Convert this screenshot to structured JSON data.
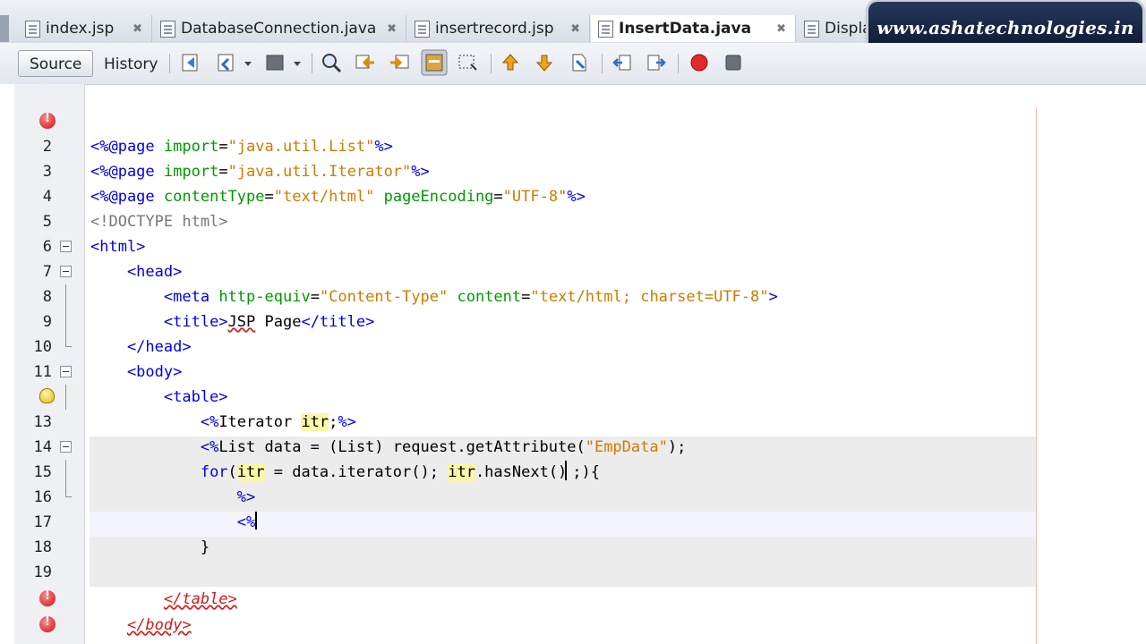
{
  "tabs": [
    {
      "label": "index.jsp",
      "active": false
    },
    {
      "label": "DatabaseConnection.java",
      "active": false
    },
    {
      "label": "insertrecord.jsp",
      "active": false
    },
    {
      "label": "InsertData.java",
      "active": true
    },
    {
      "label": "Displa",
      "active": false
    }
  ],
  "watermark": "www.ashatechnologies.in",
  "toolbar": {
    "source_label": "Source",
    "history_label": "History",
    "icons": [
      "last-edit-icon",
      "back-icon",
      "dropdown-icon",
      "forward-icon",
      "dropdown-icon",
      "find-icon",
      "find-previous-icon",
      "find-next-icon",
      "toggle-highlight-icon",
      "toggle-rectangular-selection-icon",
      "previous-bookmark-icon",
      "next-bookmark-icon",
      "toggle-bookmark-icon",
      "shift-left-icon",
      "shift-right-icon",
      "start-macro-icon",
      "stop-macro-icon"
    ]
  },
  "editor": {
    "lines": [
      {
        "n": "",
        "text": ""
      },
      {
        "n": "2",
        "text": "<%@page import=\"java.util.List\"%>"
      },
      {
        "n": "3",
        "text": "<%@page import=\"java.util.Iterator\"%>"
      },
      {
        "n": "4",
        "text": "<%@page contentType=\"text/html\" pageEncoding=\"UTF-8\"%>"
      },
      {
        "n": "5",
        "text": "<!DOCTYPE html>"
      },
      {
        "n": "6",
        "text": "<html>"
      },
      {
        "n": "7",
        "text": "    <head>"
      },
      {
        "n": "8",
        "text": "        <meta http-equiv=\"Content-Type\" content=\"text/html; charset=UTF-8\">"
      },
      {
        "n": "9",
        "text": "        <title>JSP Page</title>"
      },
      {
        "n": "10",
        "text": "    </head>"
      },
      {
        "n": "11",
        "text": "    <body>"
      },
      {
        "n": "",
        "text": "        <table>"
      },
      {
        "n": "13",
        "text": "            <%Iterator itr;%>"
      },
      {
        "n": "14",
        "text": "            <%List data = (List) request.getAttribute(\"EmpData\");"
      },
      {
        "n": "15",
        "text": "            for(itr = data.iterator(); itr.hasNext();){"
      },
      {
        "n": "16",
        "text": "                %>"
      },
      {
        "n": "17",
        "text": "                <%"
      },
      {
        "n": "18",
        "text": "            }"
      },
      {
        "n": "19",
        "text": ""
      },
      {
        "n": "",
        "text": "        </table>"
      },
      {
        "n": "",
        "text": "    </body>"
      }
    ]
  },
  "colors": {
    "tag": "#0000e6",
    "string": "#ce7b00",
    "attribute": "#009900",
    "error": "#d21b1b",
    "variable_highlight": "#fbf6a8"
  }
}
